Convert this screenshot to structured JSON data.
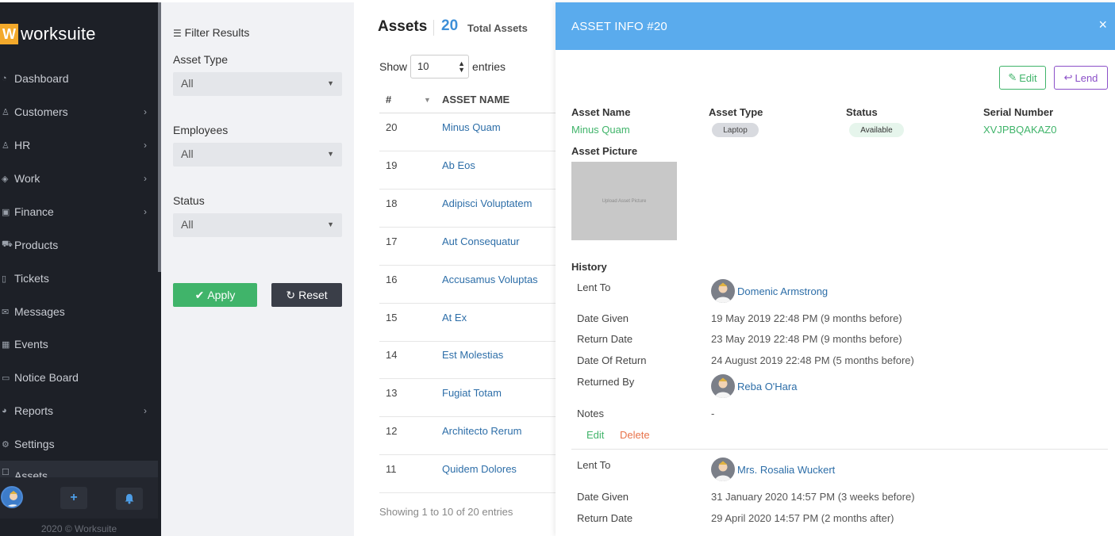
{
  "sidebar": {
    "logo_letter": "W",
    "logo_text": "worksuite",
    "items": [
      {
        "label": "Dashboard",
        "icon": "gauge-icon",
        "has_children": false
      },
      {
        "label": "Customers",
        "icon": "users-icon",
        "has_children": true
      },
      {
        "label": "HR",
        "icon": "user-icon",
        "has_children": true
      },
      {
        "label": "Work",
        "icon": "layers-icon",
        "has_children": true
      },
      {
        "label": "Finance",
        "icon": "money-icon",
        "has_children": true
      },
      {
        "label": "Products",
        "icon": "cart-icon",
        "has_children": false
      },
      {
        "label": "Tickets",
        "icon": "ticket-icon",
        "has_children": false
      },
      {
        "label": "Messages",
        "icon": "envelope-icon",
        "has_children": false
      },
      {
        "label": "Events",
        "icon": "calendar-icon",
        "has_children": false
      },
      {
        "label": "Notice Board",
        "icon": "clipboard-icon",
        "has_children": false
      },
      {
        "label": "Reports",
        "icon": "pie-chart-icon",
        "has_children": true
      },
      {
        "label": "Settings",
        "icon": "gear-icon",
        "has_children": false
      },
      {
        "label": "Assets",
        "icon": "box-icon",
        "has_children": false
      }
    ],
    "copyright": "2020 © Worksuite"
  },
  "filter": {
    "title": "Filter Results",
    "asset_type_label": "Asset Type",
    "asset_type_value": "All",
    "employees_label": "Employees",
    "employees_value": "All",
    "status_label": "Status",
    "status_value": "All",
    "apply_label": "Apply",
    "reset_label": "Reset"
  },
  "assets": {
    "title": "Assets",
    "count": "20",
    "count_label": "Total Assets",
    "show_label": "Show",
    "entries_value": "10",
    "entries_label": "entries",
    "col_num": "#",
    "col_name": "ASSET NAME",
    "rows": [
      {
        "num": "20",
        "name": "Minus Quam"
      },
      {
        "num": "19",
        "name": "Ab Eos"
      },
      {
        "num": "18",
        "name": "Adipisci Voluptatem"
      },
      {
        "num": "17",
        "name": "Aut Consequatur"
      },
      {
        "num": "16",
        "name": "Accusamus Voluptas"
      },
      {
        "num": "15",
        "name": "At Ex"
      },
      {
        "num": "14",
        "name": "Est Molestias"
      },
      {
        "num": "13",
        "name": "Fugiat Totam"
      },
      {
        "num": "12",
        "name": "Architecto Rerum"
      },
      {
        "num": "11",
        "name": "Quidem Dolores"
      }
    ],
    "showing": "Showing 1 to 10 of 20 entries"
  },
  "panel": {
    "title": "ASSET INFO #20",
    "close": "×",
    "edit_label": "Edit",
    "lend_label": "Lend",
    "asset_name_label": "Asset Name",
    "asset_name": "Minus Quam",
    "asset_type_label": "Asset Type",
    "asset_type": "Laptop",
    "status_label": "Status",
    "status": "Available",
    "serial_label": "Serial Number",
    "serial": "XVJPBQAKAZ0",
    "picture_label": "Asset Picture",
    "picture_placeholder": "Upload Asset Picture",
    "history_title": "History",
    "history": [
      {
        "lent_to_label": "Lent To",
        "lent_to": "Domenic Armstrong",
        "date_given_label": "Date Given",
        "date_given": "19 May 2019 22:48 PM (9 months before)",
        "return_date_label": "Return Date",
        "return_date": "23 May 2019 22:48 PM (9 months before)",
        "date_of_return_label": "Date Of Return",
        "date_of_return": "24 August 2019 22:48 PM (5 months before)",
        "returned_by_label": "Returned By",
        "returned_by": "Reba O'Hara",
        "notes_label": "Notes",
        "notes": "-",
        "edit_label": "Edit",
        "delete_label": "Delete"
      },
      {
        "lent_to_label": "Lent To",
        "lent_to": "Mrs. Rosalia Wuckert",
        "date_given_label": "Date Given",
        "date_given": "31 January 2020 14:57 PM (3 weeks before)",
        "return_date_label": "Return Date",
        "return_date": "29 April 2020 14:57 PM (2 months after)"
      }
    ]
  },
  "colors": {
    "sidebar_bg": "#1d2027",
    "panel_header": "#5aabed",
    "green": "#40b46a",
    "purple": "#8b4fc8",
    "link_blue": "#2d6ea8",
    "delete_orange": "#e8734a"
  }
}
